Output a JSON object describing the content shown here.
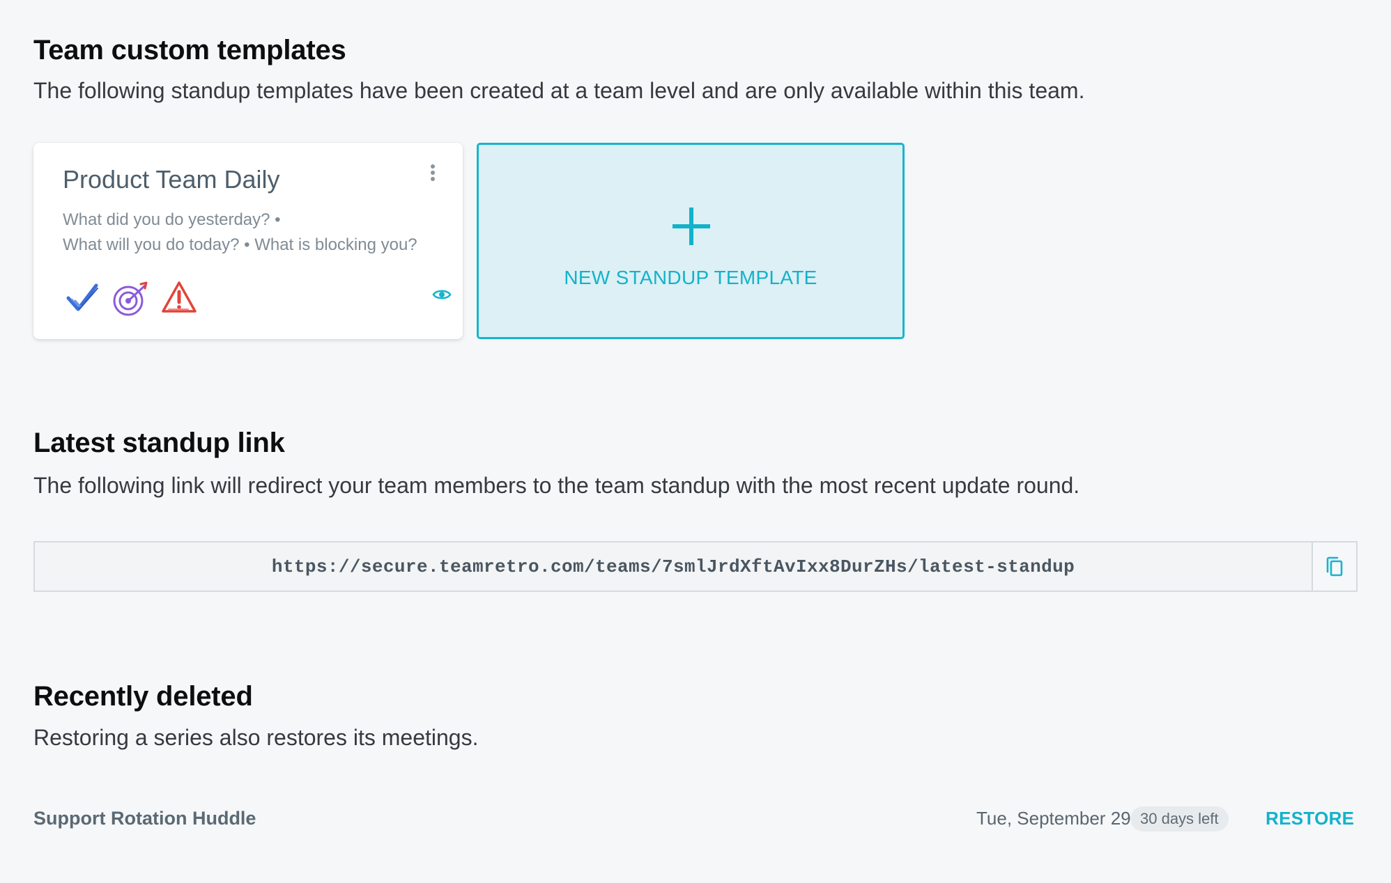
{
  "templates_section": {
    "title": "Team custom templates",
    "description": "The following standup templates have been created at a team level and are only available within this team."
  },
  "template_card": {
    "title": "Product Team Daily",
    "questions_line1": "What did you do yesterday? •",
    "questions_line2": "What will you do today? • What is blocking you?",
    "icons": [
      "checkmark-icon",
      "target-icon",
      "warning-icon"
    ],
    "preview_icon": "eye-icon",
    "menu_icon": "kebab-menu-icon"
  },
  "new_template": {
    "label": "NEW STANDUP TEMPLATE",
    "icon": "plus-icon"
  },
  "link_section": {
    "title": "Latest standup link",
    "description": "The following link will redirect your team members to the team standup with the most recent update round.",
    "url": "https://secure.teamretro.com/teams/7smlJrdXftAvIxx8DurZHs/latest-standup",
    "copy_icon": "copy-icon"
  },
  "deleted_section": {
    "title": "Recently deleted",
    "description": "Restoring a series also restores its meetings.",
    "items": [
      {
        "name": "Support Rotation Huddle",
        "date": "Tue, September 29",
        "days_left": "30 days left",
        "restore_label": "RESTORE"
      }
    ]
  },
  "colors": {
    "accent": "#15b5cd",
    "new_template_bg": "#dcf0f5",
    "page_bg": "#f6f7f9",
    "checkmark": "#3a6fd8",
    "target": "#8b5bd8",
    "warning": "#e0443a"
  }
}
